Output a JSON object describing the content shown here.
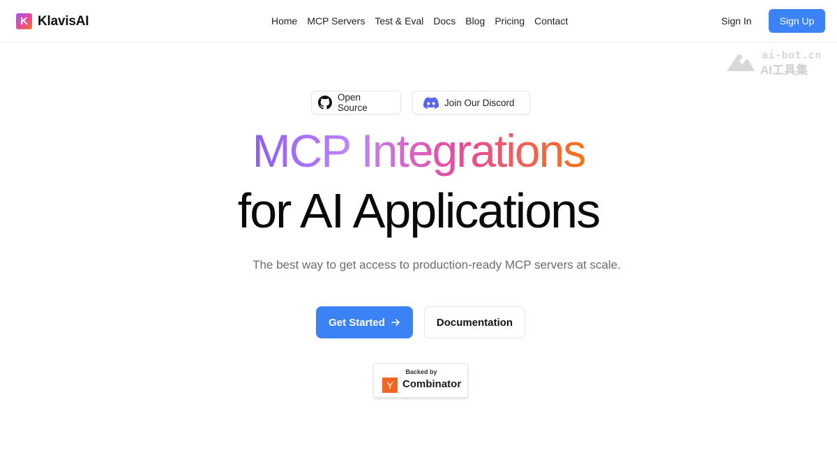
{
  "nav": {
    "brand": {
      "logo_letter": "K",
      "name": "KlavisAI"
    },
    "links": [
      "Home",
      "MCP Servers",
      "Test & Eval",
      "Docs",
      "Blog",
      "Pricing",
      "Contact"
    ],
    "sign_in": "Sign In",
    "sign_up": "Sign Up"
  },
  "watermark": {
    "url": "ai-bot.cn",
    "name": "AI工具集"
  },
  "badges": {
    "open_source": {
      "label": "Open Source",
      "icon": "github-icon"
    },
    "discord": {
      "label": "Join Our Discord",
      "icon": "discord-icon"
    }
  },
  "hero": {
    "title_line1": "MCP Integrations",
    "title_line2": "for AI Applications",
    "subtitle": "The best way to get access to production-ready MCP servers at scale."
  },
  "cta": {
    "primary": "Get Started",
    "primary_icon": "arrow-right-icon",
    "secondary": "Documentation"
  },
  "yc": {
    "backed_by": "Backed by",
    "logo_letter": "Y",
    "name": "Combinator"
  },
  "colors": {
    "accent": "#3b82f6",
    "gradient": [
      "#8b5cf6",
      "#ec4899",
      "#f97316"
    ],
    "yc_orange": "#f26522",
    "discord": "#5865f2"
  }
}
